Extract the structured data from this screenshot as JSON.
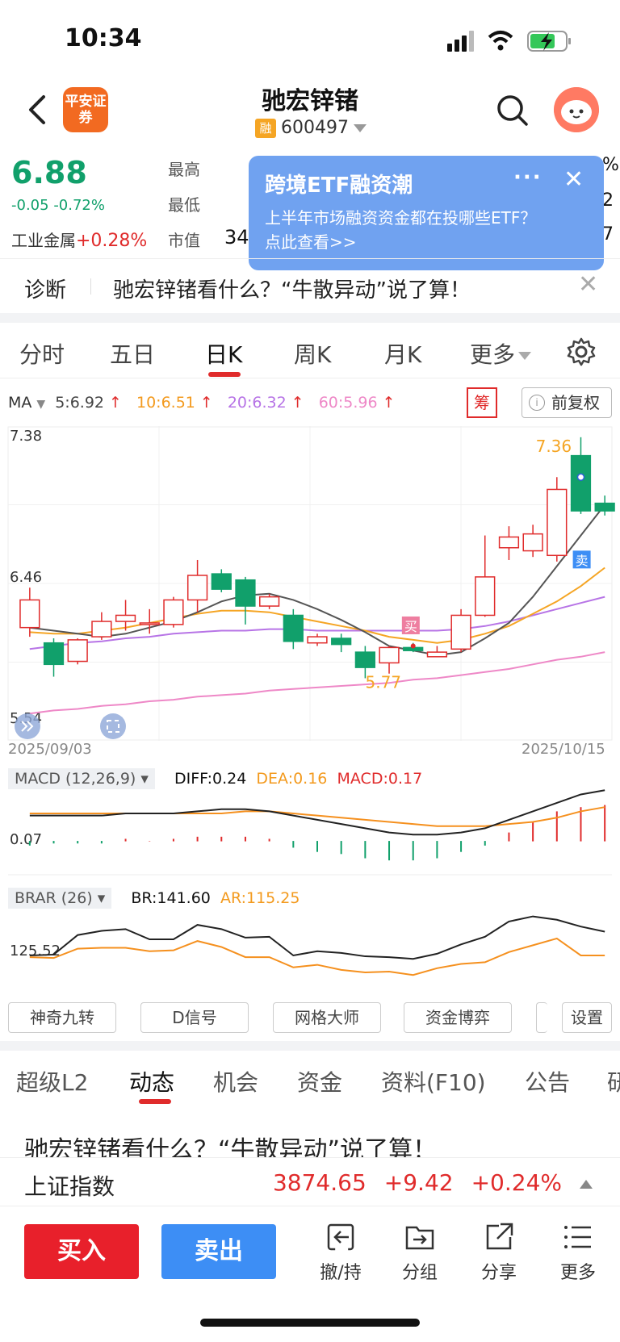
{
  "status": {
    "time": "10:34"
  },
  "header": {
    "logo_text": "平安证券",
    "stock_name": "驰宏锌锗",
    "rong_badge": "融",
    "stock_code": "600497"
  },
  "quote": {
    "price": "6.88",
    "change": "-0.05",
    "change_pct": "-0.72%",
    "industry_name": "工业金属",
    "industry_pct": "+0.28%",
    "label_high": "最高",
    "label_low": "最低",
    "label_mktval": "市值",
    "mktval_partial": "34",
    "right_clip_1": "%",
    "right_clip_2": "2",
    "right_clip_3": "7"
  },
  "popup": {
    "title": "跨境ETF融资潮",
    "body": "上半年市场融资资金都在投哪些ETF？点此查看>>",
    "dots": "···",
    "close": "✕"
  },
  "diagnosis": {
    "label": "诊断",
    "text": "驰宏锌锗看什么？“牛散异动”说了算！",
    "close": "✕"
  },
  "chart_tabs": [
    {
      "label": "分时"
    },
    {
      "label": "五日"
    },
    {
      "label": "日K"
    },
    {
      "label": "周K"
    },
    {
      "label": "月K"
    },
    {
      "label": "更多"
    }
  ],
  "ma": {
    "label": "MA",
    "ma5": "5:6.92",
    "ma10": "10:6.51",
    "ma20": "20:6.32",
    "ma60": "60:5.96",
    "arrow": "↑",
    "chou": "筹",
    "fuquan": "前复权",
    "info_icon": "i"
  },
  "colors": {
    "up": "#e02b2b",
    "down": "#11a06b",
    "ma5": "#555555",
    "ma10": "#f5a524",
    "ma20": "#b774e6",
    "ma60": "#ee88c7",
    "accent_blue": "#3d8ef5"
  },
  "chart_data": {
    "type": "candlestick",
    "y_ticks": [
      "7.38",
      "6.46",
      "5.54"
    ],
    "ylim": [
      5.54,
      7.38
    ],
    "start_date": "2025/09/03",
    "end_date": "2025/10/15",
    "high_label": "7.36",
    "low_label": "5.77",
    "buy_marker": "买",
    "sell_marker": "卖",
    "candles": [
      {
        "o": 6.12,
        "c": 6.3,
        "h": 6.38,
        "l": 6.06
      },
      {
        "o": 6.02,
        "c": 5.88,
        "h": 6.05,
        "l": 5.8
      },
      {
        "o": 5.9,
        "c": 6.04,
        "h": 6.05,
        "l": 5.88
      },
      {
        "o": 6.06,
        "c": 6.16,
        "h": 6.22,
        "l": 6.04
      },
      {
        "o": 6.16,
        "c": 6.2,
        "h": 6.3,
        "l": 6.1
      },
      {
        "o": 6.14,
        "c": 6.15,
        "h": 6.24,
        "l": 6.08
      },
      {
        "o": 6.14,
        "c": 6.3,
        "h": 6.32,
        "l": 6.12
      },
      {
        "o": 6.3,
        "c": 6.46,
        "h": 6.56,
        "l": 6.22
      },
      {
        "o": 6.47,
        "c": 6.37,
        "h": 6.5,
        "l": 6.35
      },
      {
        "o": 6.43,
        "c": 6.26,
        "h": 6.45,
        "l": 6.14
      },
      {
        "o": 6.26,
        "c": 6.32,
        "h": 6.34,
        "l": 6.24
      },
      {
        "o": 6.2,
        "c": 6.03,
        "h": 6.24,
        "l": 5.98
      },
      {
        "o": 6.02,
        "c": 6.06,
        "h": 6.08,
        "l": 6.0
      },
      {
        "o": 6.05,
        "c": 6.01,
        "h": 6.08,
        "l": 5.96
      },
      {
        "o": 5.96,
        "c": 5.86,
        "h": 6.0,
        "l": 5.79
      },
      {
        "o": 5.89,
        "c": 5.99,
        "h": 6.0,
        "l": 5.82
      },
      {
        "o": 5.99,
        "c": 5.97,
        "h": 6.02,
        "l": 5.96
      },
      {
        "o": 5.93,
        "c": 5.96,
        "h": 6.0,
        "l": 5.93
      },
      {
        "o": 5.98,
        "c": 6.2,
        "h": 6.24,
        "l": 5.96
      },
      {
        "o": 6.2,
        "c": 6.45,
        "h": 6.72,
        "l": 6.19
      },
      {
        "o": 6.64,
        "c": 6.71,
        "h": 6.78,
        "l": 6.56
      },
      {
        "o": 6.62,
        "c": 6.73,
        "h": 6.79,
        "l": 6.58
      },
      {
        "o": 6.59,
        "c": 7.02,
        "h": 7.1,
        "l": 6.55
      },
      {
        "o": 7.24,
        "c": 6.88,
        "h": 7.36,
        "l": 6.86
      },
      {
        "o": 6.93,
        "c": 6.88,
        "h": 6.98,
        "l": 6.85
      }
    ],
    "ma5": [
      6.12,
      6.1,
      6.08,
      6.06,
      6.08,
      6.12,
      6.16,
      6.22,
      6.29,
      6.33,
      6.34,
      6.3,
      6.24,
      6.17,
      6.09,
      6.0,
      5.97,
      5.94,
      5.96,
      6.05,
      6.15,
      6.32,
      6.52,
      6.72,
      6.92
    ],
    "ma10": [
      6.09,
      6.08,
      6.08,
      6.1,
      6.12,
      6.15,
      6.18,
      6.21,
      6.23,
      6.23,
      6.22,
      6.19,
      6.16,
      6.13,
      6.1,
      6.06,
      6.04,
      6.02,
      6.04,
      6.08,
      6.13,
      6.21,
      6.29,
      6.39,
      6.51
    ],
    "ma20": [
      5.98,
      6.0,
      6.02,
      6.03,
      6.05,
      6.06,
      6.08,
      6.09,
      6.1,
      6.1,
      6.11,
      6.11,
      6.1,
      6.1,
      6.1,
      6.1,
      6.1,
      6.1,
      6.11,
      6.13,
      6.16,
      6.2,
      6.24,
      6.28,
      6.32
    ],
    "ma60": [
      5.56,
      5.58,
      5.59,
      5.61,
      5.62,
      5.64,
      5.65,
      5.67,
      5.68,
      5.69,
      5.71,
      5.72,
      5.73,
      5.74,
      5.75,
      5.76,
      5.78,
      5.79,
      5.81,
      5.83,
      5.85,
      5.88,
      5.91,
      5.93,
      5.96
    ]
  },
  "macd": {
    "label": "MACD (12,26,9)",
    "diff": "DIFF:0.24",
    "dea": "DEA:0.16",
    "macd": "MACD:0.17",
    "tick": "0.07",
    "ylim": [
      -0.16,
      0.26
    ],
    "diff_series": [
      0.12,
      0.12,
      0.12,
      0.12,
      0.13,
      0.13,
      0.13,
      0.14,
      0.15,
      0.15,
      0.14,
      0.12,
      0.1,
      0.08,
      0.06,
      0.04,
      0.03,
      0.03,
      0.04,
      0.06,
      0.1,
      0.14,
      0.18,
      0.22,
      0.24
    ],
    "dea_series": [
      0.13,
      0.13,
      0.13,
      0.13,
      0.13,
      0.13,
      0.13,
      0.13,
      0.13,
      0.14,
      0.14,
      0.13,
      0.12,
      0.11,
      0.1,
      0.09,
      0.08,
      0.07,
      0.07,
      0.07,
      0.08,
      0.09,
      0.11,
      0.14,
      0.16
    ],
    "bars": [
      -0.02,
      -0.01,
      -0.01,
      -0.01,
      0.01,
      0.0,
      0.01,
      0.02,
      0.02,
      0.02,
      0.01,
      -0.03,
      -0.05,
      -0.06,
      -0.08,
      -0.09,
      -0.09,
      -0.08,
      -0.05,
      -0.02,
      0.04,
      0.09,
      0.14,
      0.16,
      0.17
    ]
  },
  "brar": {
    "label": "BRAR (26)",
    "br": "BR:141.60",
    "ar": "AR:115.25",
    "tick": "125.52",
    "ylim": [
      80,
      175
    ],
    "br_series": [
      118,
      119,
      142,
      147,
      149,
      137,
      137,
      154,
      149,
      139,
      140,
      118,
      123,
      121,
      117,
      116,
      114,
      120,
      131,
      140,
      158,
      164,
      160,
      152,
      146
    ],
    "ar_series": [
      116,
      115,
      126,
      127,
      127,
      123,
      124,
      135,
      128,
      116,
      116,
      104,
      107,
      101,
      98,
      99,
      95,
      103,
      108,
      110,
      122,
      130,
      138,
      118,
      118
    ]
  },
  "tools": [
    "神奇九转",
    "D信号",
    "网格大师",
    "资金博弈",
    "",
    "设置"
  ],
  "bottom_tabs": [
    {
      "label": "超级L2"
    },
    {
      "label": "动态"
    },
    {
      "label": "机会"
    },
    {
      "label": "资金"
    },
    {
      "label": "资料(F10)"
    },
    {
      "label": "公告"
    },
    {
      "label": "研"
    }
  ],
  "news_headline": "驰宏锌锗看什么？“牛散异动”说了算！",
  "index_bar": {
    "name": "上证指数",
    "value": "3874.65",
    "change": "+9.42",
    "change_pct": "+0.24%"
  },
  "actions": {
    "buy": "买入",
    "sell": "卖出",
    "revoke": "撤/持",
    "group": "分组",
    "share": "分享",
    "more": "更多"
  }
}
